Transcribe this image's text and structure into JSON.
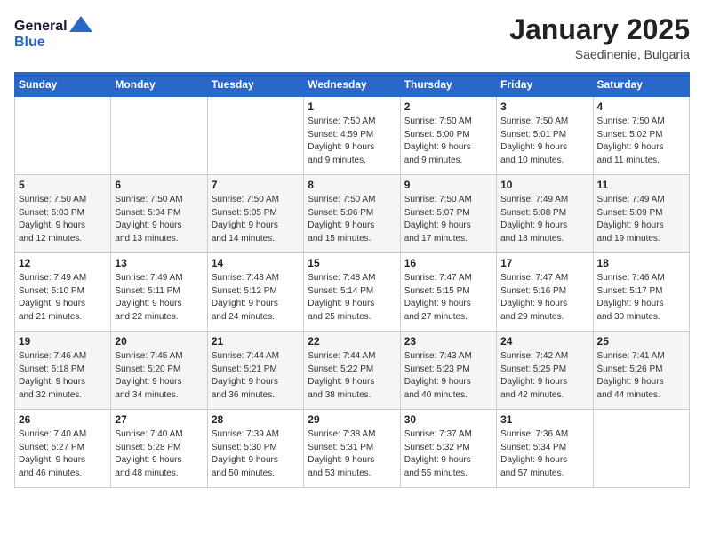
{
  "logo": {
    "general": "General",
    "blue": "Blue"
  },
  "header": {
    "month": "January 2025",
    "location": "Saedinenie, Bulgaria"
  },
  "weekdays": [
    "Sunday",
    "Monday",
    "Tuesday",
    "Wednesday",
    "Thursday",
    "Friday",
    "Saturday"
  ],
  "weeks": [
    [
      {
        "day": "",
        "info": ""
      },
      {
        "day": "",
        "info": ""
      },
      {
        "day": "",
        "info": ""
      },
      {
        "day": "1",
        "info": "Sunrise: 7:50 AM\nSunset: 4:59 PM\nDaylight: 9 hours\nand 9 minutes."
      },
      {
        "day": "2",
        "info": "Sunrise: 7:50 AM\nSunset: 5:00 PM\nDaylight: 9 hours\nand 9 minutes."
      },
      {
        "day": "3",
        "info": "Sunrise: 7:50 AM\nSunset: 5:01 PM\nDaylight: 9 hours\nand 10 minutes."
      },
      {
        "day": "4",
        "info": "Sunrise: 7:50 AM\nSunset: 5:02 PM\nDaylight: 9 hours\nand 11 minutes."
      }
    ],
    [
      {
        "day": "5",
        "info": "Sunrise: 7:50 AM\nSunset: 5:03 PM\nDaylight: 9 hours\nand 12 minutes."
      },
      {
        "day": "6",
        "info": "Sunrise: 7:50 AM\nSunset: 5:04 PM\nDaylight: 9 hours\nand 13 minutes."
      },
      {
        "day": "7",
        "info": "Sunrise: 7:50 AM\nSunset: 5:05 PM\nDaylight: 9 hours\nand 14 minutes."
      },
      {
        "day": "8",
        "info": "Sunrise: 7:50 AM\nSunset: 5:06 PM\nDaylight: 9 hours\nand 15 minutes."
      },
      {
        "day": "9",
        "info": "Sunrise: 7:50 AM\nSunset: 5:07 PM\nDaylight: 9 hours\nand 17 minutes."
      },
      {
        "day": "10",
        "info": "Sunrise: 7:49 AM\nSunset: 5:08 PM\nDaylight: 9 hours\nand 18 minutes."
      },
      {
        "day": "11",
        "info": "Sunrise: 7:49 AM\nSunset: 5:09 PM\nDaylight: 9 hours\nand 19 minutes."
      }
    ],
    [
      {
        "day": "12",
        "info": "Sunrise: 7:49 AM\nSunset: 5:10 PM\nDaylight: 9 hours\nand 21 minutes."
      },
      {
        "day": "13",
        "info": "Sunrise: 7:49 AM\nSunset: 5:11 PM\nDaylight: 9 hours\nand 22 minutes."
      },
      {
        "day": "14",
        "info": "Sunrise: 7:48 AM\nSunset: 5:12 PM\nDaylight: 9 hours\nand 24 minutes."
      },
      {
        "day": "15",
        "info": "Sunrise: 7:48 AM\nSunset: 5:14 PM\nDaylight: 9 hours\nand 25 minutes."
      },
      {
        "day": "16",
        "info": "Sunrise: 7:47 AM\nSunset: 5:15 PM\nDaylight: 9 hours\nand 27 minutes."
      },
      {
        "day": "17",
        "info": "Sunrise: 7:47 AM\nSunset: 5:16 PM\nDaylight: 9 hours\nand 29 minutes."
      },
      {
        "day": "18",
        "info": "Sunrise: 7:46 AM\nSunset: 5:17 PM\nDaylight: 9 hours\nand 30 minutes."
      }
    ],
    [
      {
        "day": "19",
        "info": "Sunrise: 7:46 AM\nSunset: 5:18 PM\nDaylight: 9 hours\nand 32 minutes."
      },
      {
        "day": "20",
        "info": "Sunrise: 7:45 AM\nSunset: 5:20 PM\nDaylight: 9 hours\nand 34 minutes."
      },
      {
        "day": "21",
        "info": "Sunrise: 7:44 AM\nSunset: 5:21 PM\nDaylight: 9 hours\nand 36 minutes."
      },
      {
        "day": "22",
        "info": "Sunrise: 7:44 AM\nSunset: 5:22 PM\nDaylight: 9 hours\nand 38 minutes."
      },
      {
        "day": "23",
        "info": "Sunrise: 7:43 AM\nSunset: 5:23 PM\nDaylight: 9 hours\nand 40 minutes."
      },
      {
        "day": "24",
        "info": "Sunrise: 7:42 AM\nSunset: 5:25 PM\nDaylight: 9 hours\nand 42 minutes."
      },
      {
        "day": "25",
        "info": "Sunrise: 7:41 AM\nSunset: 5:26 PM\nDaylight: 9 hours\nand 44 minutes."
      }
    ],
    [
      {
        "day": "26",
        "info": "Sunrise: 7:40 AM\nSunset: 5:27 PM\nDaylight: 9 hours\nand 46 minutes."
      },
      {
        "day": "27",
        "info": "Sunrise: 7:40 AM\nSunset: 5:28 PM\nDaylight: 9 hours\nand 48 minutes."
      },
      {
        "day": "28",
        "info": "Sunrise: 7:39 AM\nSunset: 5:30 PM\nDaylight: 9 hours\nand 50 minutes."
      },
      {
        "day": "29",
        "info": "Sunrise: 7:38 AM\nSunset: 5:31 PM\nDaylight: 9 hours\nand 53 minutes."
      },
      {
        "day": "30",
        "info": "Sunrise: 7:37 AM\nSunset: 5:32 PM\nDaylight: 9 hours\nand 55 minutes."
      },
      {
        "day": "31",
        "info": "Sunrise: 7:36 AM\nSunset: 5:34 PM\nDaylight: 9 hours\nand 57 minutes."
      },
      {
        "day": "",
        "info": ""
      }
    ]
  ]
}
